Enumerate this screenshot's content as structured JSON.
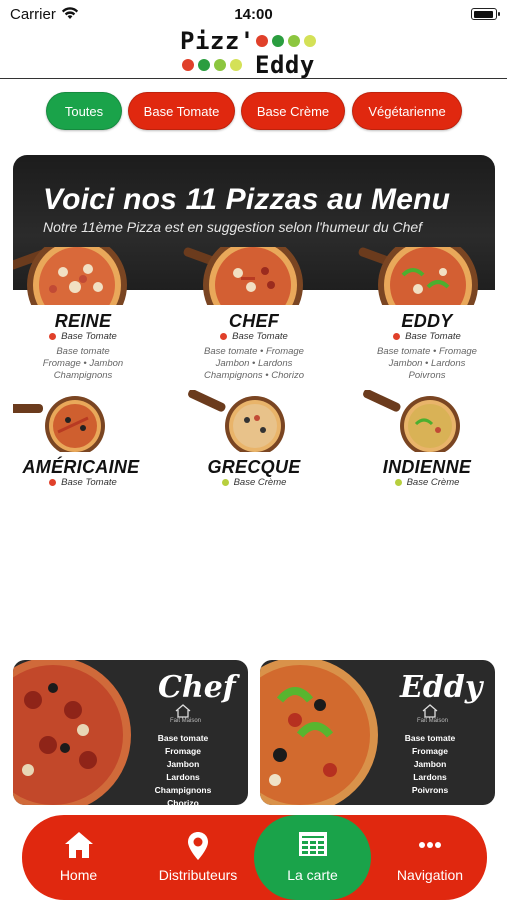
{
  "status_bar": {
    "carrier": "Carrier",
    "time": "14:00",
    "battery_level": 0.95
  },
  "logo": {
    "line1": "Pizz'",
    "line2": "Eddy"
  },
  "filters": [
    {
      "label": "Toutes",
      "color": "#1aa34a",
      "selected": true
    },
    {
      "label": "Base Tomate",
      "color": "#e0280f",
      "selected": false
    },
    {
      "label": "Base Crème",
      "color": "#e0280f",
      "selected": false
    },
    {
      "label": "Végétarienne",
      "color": "#e0280f",
      "selected": false
    }
  ],
  "menu": {
    "title": "Voici nos 11 Pizzas au Menu",
    "subtitle": "Notre 11ème Pizza est en suggestion selon l'humeur du Chef",
    "pizzas": [
      {
        "name": "REINE",
        "base": "Base Tomate",
        "base_color": "#e0402a",
        "ingredients": [
          "Base tomate",
          "Fromage • Jambon",
          "Champignons"
        ]
      },
      {
        "name": "CHEF",
        "base": "Base Tomate",
        "base_color": "#e0402a",
        "ingredients": [
          "Base tomate • Fromage",
          "Jambon • Lardons",
          "Champignons • Chorizo"
        ]
      },
      {
        "name": "EDDY",
        "base": "Base Tomate",
        "base_color": "#e0402a",
        "ingredients": [
          "Base tomate • Fromage",
          "Jambon • Lardons",
          "Poivrons"
        ]
      },
      {
        "name": "AMÉRICAINE",
        "base": "Base Tomate",
        "base_color": "#e0402a",
        "ingredients": []
      },
      {
        "name": "GRECQUE",
        "base": "Base Crème",
        "base_color": "#b7cf3e",
        "ingredients": []
      },
      {
        "name": "INDIENNE",
        "base": "Base Crème",
        "base_color": "#b7cf3e",
        "ingredients": []
      }
    ]
  },
  "promos": [
    {
      "title": "Chef",
      "tag": "Fait Maison",
      "ingredients": [
        "Base tomate",
        "Fromage",
        "Jambon",
        "Lardons",
        "Champignons",
        "Chorizo"
      ]
    },
    {
      "title": "Eddy",
      "tag": "Fait Maison",
      "ingredients": [
        "Base tomate",
        "Fromage",
        "Jambon",
        "Lardons",
        "Poivrons"
      ]
    }
  ],
  "nav": [
    {
      "label": "Home",
      "icon": "home-icon",
      "active": false
    },
    {
      "label": "Distributeurs",
      "icon": "map-pin-icon",
      "active": false
    },
    {
      "label": "La carte",
      "icon": "menu-card-icon",
      "active": true
    },
    {
      "label": "Navigation",
      "icon": "more-dots-icon",
      "active": false
    }
  ],
  "colors": {
    "brand_red": "#e0280f",
    "brand_green": "#1aa34a",
    "dark_band": "#1c1c1c"
  }
}
